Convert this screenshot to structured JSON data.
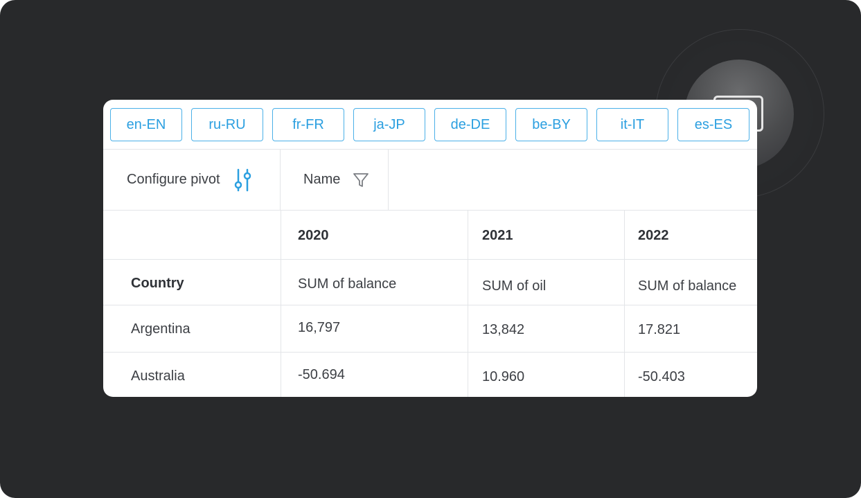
{
  "locales": [
    "en-EN",
    "ru-RU",
    "fr-FR",
    "ja-JP",
    "de-DE",
    "be-BY",
    "it-IT",
    "es-ES"
  ],
  "toolbar": {
    "configure_label": "Configure pivot",
    "name_filter_label": "Name"
  },
  "pivot": {
    "years": [
      "2020",
      "2021",
      "2022"
    ],
    "row_header": "Country",
    "measures": [
      "SUM of balance",
      "SUM of oil",
      "SUM of balance"
    ],
    "rows": [
      {
        "country": "Argentina",
        "values": [
          "16,797",
          "13,842",
          "17.821"
        ]
      },
      {
        "country": "Australia",
        "values": [
          "-50.694",
          "10.960",
          "-50.403"
        ]
      }
    ]
  },
  "colors": {
    "accent": "#2b9fe0",
    "background": "#28292b",
    "card": "#ffffff"
  }
}
